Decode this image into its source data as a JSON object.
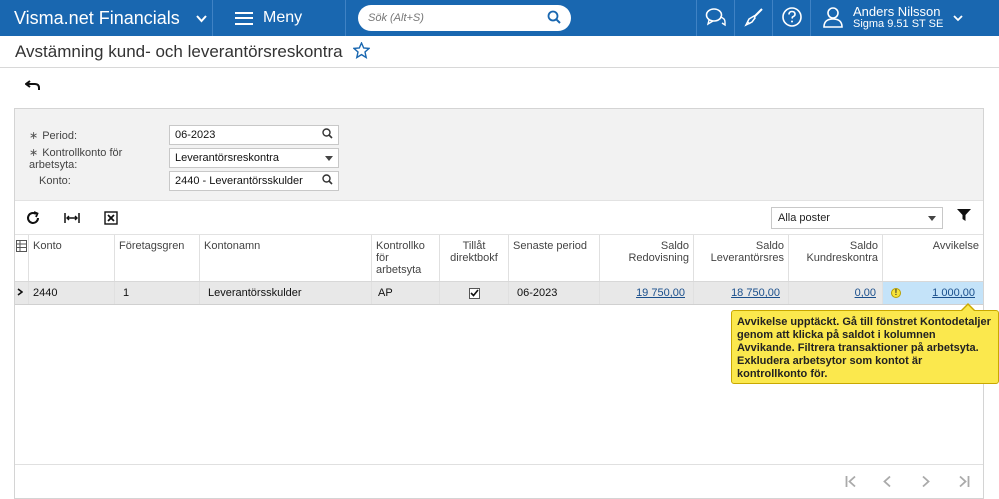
{
  "topbar": {
    "brand": "Visma.net Financials",
    "menu_label": "Meny",
    "search_placeholder": "Sök (Alt+S)",
    "user_name": "Anders Nilsson",
    "user_company": "Sigma 9.51 ST SE"
  },
  "page": {
    "title": "Avstämning kund- och leverantörsreskontra"
  },
  "form": {
    "period_label": "Period:",
    "period_value": "06-2023",
    "control_label": "Kontrollkonto för arbetsyta:",
    "control_value": "Leverantörsreskontra",
    "account_label": "Konto:",
    "account_value": "2440 - Leverantörsskulder"
  },
  "toolbar": {
    "filter_select": "Alla poster"
  },
  "grid": {
    "columns": [
      {
        "key": "konto",
        "label": "Konto"
      },
      {
        "key": "foretagsgren",
        "label": "Företagsgren"
      },
      {
        "key": "kontonamn",
        "label": "Kontonamn"
      },
      {
        "key": "kontroll",
        "label": "Kontrollko för arbetsyta"
      },
      {
        "key": "tillat",
        "label": "Tillåt direktbokf"
      },
      {
        "key": "senaste",
        "label": "Senaste period"
      },
      {
        "key": "saldo_red",
        "label": "Saldo Redovisning"
      },
      {
        "key": "saldo_lev",
        "label": "Saldo Leverantörsres"
      },
      {
        "key": "saldo_kund",
        "label": "Saldo Kundreskontra"
      },
      {
        "key": "avvikelse",
        "label": "Avvikelse"
      }
    ],
    "rows": [
      {
        "konto": "2440",
        "foretagsgren": "1",
        "kontonamn": "Leverantörsskulder",
        "kontroll": "AP",
        "tillat": true,
        "senaste": "06-2023",
        "saldo_red": "19 750,00",
        "saldo_lev": "18 750,00",
        "saldo_kund": "0,00",
        "avvikelse": "1 000,00"
      }
    ]
  },
  "tooltip": {
    "text": "Avvikelse upptäckt. Gå till fönstret Kontodetaljer genom att klicka på saldot i kolumnen Avvikande. Filtrera transaktioner på arbetsyta. Exkludera arbetsytor som kontot är kontrollkonto för."
  },
  "colors": {
    "topbar": "#1967b0",
    "link": "#1a4f8c",
    "tooltip_bg": "#fbe84d",
    "highlight_cell": "#c4e3f9"
  },
  "icons": [
    "chevron-down-icon",
    "hamburger-icon",
    "search-icon",
    "chat-icon",
    "brush-icon",
    "help-icon",
    "user-icon",
    "star-icon",
    "undo-icon",
    "refresh-icon",
    "fit-columns-icon",
    "export-excel-icon",
    "filter-icon",
    "warning-icon",
    "first-page-icon",
    "prev-page-icon",
    "next-page-icon",
    "last-page-icon"
  ]
}
